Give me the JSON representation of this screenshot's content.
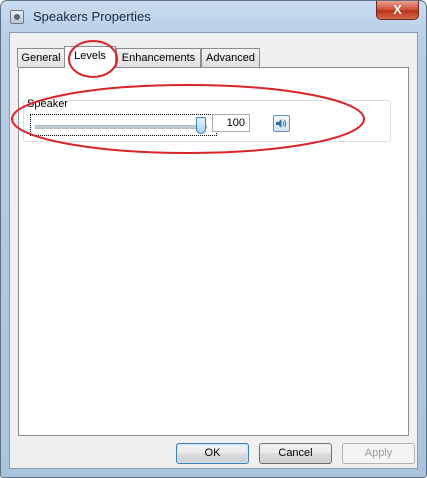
{
  "window": {
    "title": "Speakers Properties",
    "close_label": "X"
  },
  "tabs": [
    {
      "label": "General"
    },
    {
      "label": "Levels"
    },
    {
      "label": "Enhancements"
    },
    {
      "label": "Advanced"
    }
  ],
  "levels": {
    "group_label": "Speaker",
    "level_value": "100",
    "slider_fraction": 1.0
  },
  "buttons": {
    "ok": "OK",
    "cancel": "Cancel",
    "apply": "Apply"
  },
  "colors": {
    "annotation": "#d9242a",
    "accent": "#3c7fb1"
  },
  "icons": {
    "mute": "speaker-icon",
    "app": "speaker-device-icon",
    "close": "close-icon"
  }
}
